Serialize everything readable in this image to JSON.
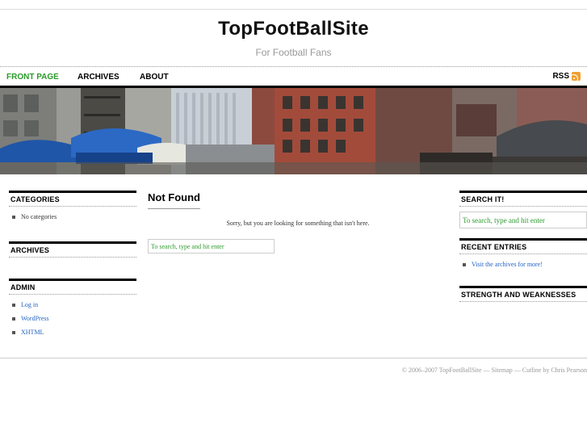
{
  "site": {
    "title": "TopFootBallSite",
    "description": "For Football Fans"
  },
  "nav": {
    "items": [
      {
        "label": "Front Page",
        "current": true
      },
      {
        "label": "Archives",
        "current": false
      },
      {
        "label": "About",
        "current": false
      }
    ],
    "rss_label": "RSS"
  },
  "left_sidebar": {
    "categories": {
      "title": "Categories",
      "items": [
        "No categories"
      ]
    },
    "archives": {
      "title": "Archives"
    },
    "admin": {
      "title": "Admin",
      "items": [
        "Log in",
        "WordPress",
        "XHTML"
      ]
    }
  },
  "main": {
    "title": "Not Found",
    "message": "Sorry, but you are looking for something that isn't here.",
    "search_placeholder": "To search, type and hit enter"
  },
  "right_sidebar": {
    "search": {
      "title": "Search It!",
      "placeholder": "To search, type and hit enter"
    },
    "recent": {
      "title": "Recent Entries",
      "items": [
        "Visit the archives for more!"
      ]
    },
    "strengths": {
      "title": "Strength and Weaknesses"
    }
  },
  "footer": {
    "copyright": "© 2006–2007 TopFootBallSite",
    "sep1": " — ",
    "sitemap": "Sitemap",
    "sep2": " — ",
    "credit": "Cutline by Chris Pearson"
  },
  "colors": {
    "accent": "#2c9b2c",
    "link": "#2563c4",
    "rss": "#f0a030"
  }
}
